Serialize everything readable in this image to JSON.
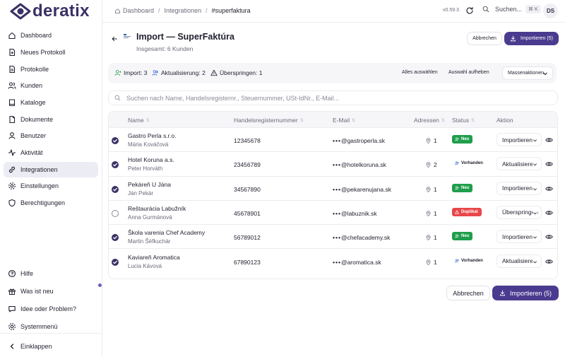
{
  "app": {
    "logo_text": "deratix",
    "version": "v0.59.3",
    "search_label": "Suchen...",
    "search_shortcut": "⌘ K",
    "avatar_initials": "DS"
  },
  "breadcrumbs": [
    "Dashboard",
    "Integrationen",
    "#superfaktura"
  ],
  "sidebar": {
    "items": [
      {
        "label": "Dashboard",
        "icon": "home-icon"
      },
      {
        "label": "Neues Protokoll",
        "icon": "document-plus-icon"
      },
      {
        "label": "Protokolle",
        "icon": "document-icon"
      },
      {
        "label": "Kunden",
        "icon": "users-icon"
      },
      {
        "label": "Kataloge",
        "icon": "book-icon"
      },
      {
        "label": "Dokumente",
        "icon": "file-icon"
      },
      {
        "label": "Benutzer",
        "icon": "user-icon"
      },
      {
        "label": "Aktivität",
        "icon": "activity-icon"
      },
      {
        "label": "Integrationen",
        "icon": "link-icon",
        "active": true
      },
      {
        "label": "Einstellungen",
        "icon": "gear-icon"
      },
      {
        "label": "Berechtigungen",
        "icon": "shield-icon"
      }
    ],
    "bottom_items": [
      {
        "label": "Hilfe",
        "icon": "help-icon"
      },
      {
        "label": "Was ist neu",
        "icon": "gift-icon"
      },
      {
        "label": "Idee oder Problem?",
        "icon": "message-icon"
      },
      {
        "label": "Systemmenü",
        "icon": "settings-icon"
      }
    ],
    "collapse_label": "Einklappen"
  },
  "page": {
    "title": "Import — SuperFaktúra",
    "subtitle": "Insgesamt: 6 Kunden",
    "cancel_label": "Abbrechen",
    "import_label": "Importieren (5)"
  },
  "summary": {
    "import": "Import: 3",
    "update": "Aktualisierung: 2",
    "skip": "Überspringen: 1",
    "select_all": "Alles auswählen",
    "deselect": "Auswahl aufheben",
    "bulk": "Massenaktionen"
  },
  "search": {
    "placeholder": "Suchen nach Name, Handelsregisternr., Steuernummer, USt-IdNr., E-Mail..."
  },
  "table": {
    "columns": [
      "Name",
      "Handelsregisternummer",
      "E-Mail",
      "Adressen",
      "Status",
      "Aktion"
    ],
    "rows": [
      {
        "selected": true,
        "name": "Gastro Perla s.r.o.",
        "contact": "Mária Kováčová",
        "reg": "12345678",
        "email": "@gastroperla.sk",
        "addresses": "1",
        "status": "Neu",
        "status_type": "new",
        "action": "Importieren"
      },
      {
        "selected": true,
        "name": "Hotel Koruna a.s.",
        "contact": "Peter Horváth",
        "reg": "23456789",
        "email": "@hotelkoruna.sk",
        "addresses": "2",
        "status": "Vorhanden",
        "status_type": "existing",
        "action": "Aktualisieren"
      },
      {
        "selected": true,
        "name": "Pekáreň U Jána",
        "contact": "Ján Pekár",
        "reg": "34567890",
        "email": "@pekarenujana.sk",
        "addresses": "1",
        "status": "Neu",
        "status_type": "new",
        "action": "Importieren"
      },
      {
        "selected": false,
        "name": "Reštaurácia Labužník",
        "contact": "Anna Gurmánová",
        "reg": "45678901",
        "email": "@labuznik.sk",
        "addresses": "1",
        "status": "Duplikat",
        "status_type": "duplicate",
        "action": "Überspringen"
      },
      {
        "selected": true,
        "name": "Škola varenia Chef Academy",
        "contact": "Martin Šéfkuchár",
        "reg": "56789012",
        "email": "@chefacademy.sk",
        "addresses": "1",
        "status": "Neu",
        "status_type": "new",
        "action": "Importieren"
      },
      {
        "selected": true,
        "name": "Kaviareň Aromatica",
        "contact": "Lucia Kávová",
        "reg": "67890123",
        "email": "@aromatica.sk",
        "addresses": "1",
        "status": "Vorhanden",
        "status_type": "existing",
        "action": "Aktualisieren"
      }
    ]
  },
  "colors": {
    "brand": "#3b3166",
    "primary_button": "#4b3b8f",
    "status_new": "#1f9e4b",
    "status_duplicate": "#e8474a",
    "active_nav_bg": "#ececf4"
  }
}
